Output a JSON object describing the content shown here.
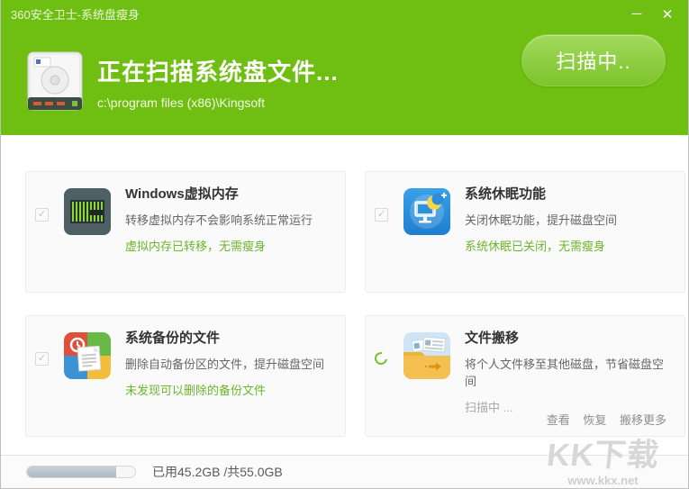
{
  "window": {
    "title": "360安全卫士-系统盘瘦身",
    "minimize_glyph": "─",
    "close_glyph": "✕"
  },
  "header": {
    "title": "正在扫描系统盘文件...",
    "path": "c:\\program files (x86)\\Kingsoft",
    "scan_button_label": "扫描中..",
    "icon": "hard-disk-icon"
  },
  "panels": [
    {
      "id": "virtual-memory",
      "icon": "memory-icon",
      "checkbox": {
        "state": "checked-disabled",
        "glyph": "✓"
      },
      "title": "Windows虚拟内存",
      "description": "转移虚拟内存不会影响系统正常运行",
      "status": "虚拟内存已转移，无需瘦身",
      "status_type": "success"
    },
    {
      "id": "hibernate",
      "icon": "hibernate-icon",
      "checkbox": {
        "state": "checked-disabled",
        "glyph": "✓"
      },
      "title": "系统休眠功能",
      "description": "关闭休眠功能，提升磁盘空间",
      "status": "系统休眠已关闭，无需瘦身",
      "status_type": "success"
    },
    {
      "id": "backup-files",
      "icon": "backup-icon",
      "checkbox": {
        "state": "checked-disabled",
        "glyph": "✓"
      },
      "title": "系统备份的文件",
      "description": "删除自动备份区的文件，提升磁盘空间",
      "status": "未发现可以删除的备份文件",
      "status_type": "success"
    },
    {
      "id": "file-move",
      "icon": "folder-move-icon",
      "spinner": true,
      "title": "文件搬移",
      "description": "将个人文件移至其他磁盘，节省磁盘空间",
      "status": "扫描中 ...",
      "status_type": "scanning",
      "links": [
        "查看",
        "恢复",
        "搬移更多"
      ]
    }
  ],
  "footer": {
    "usage_text": "已用45.2GB /共55.0GB",
    "used_gb": 45.2,
    "total_gb": 55.0
  },
  "watermark": {
    "logo": "KK下载",
    "url": "www.kkx.net"
  },
  "colors": {
    "brand_green": "#6fbe12",
    "button_green_top": "#a2d95c",
    "button_green_bottom": "#7dc42c",
    "status_green": "#6cb52d",
    "progress_fill": "#b3bfc8"
  }
}
